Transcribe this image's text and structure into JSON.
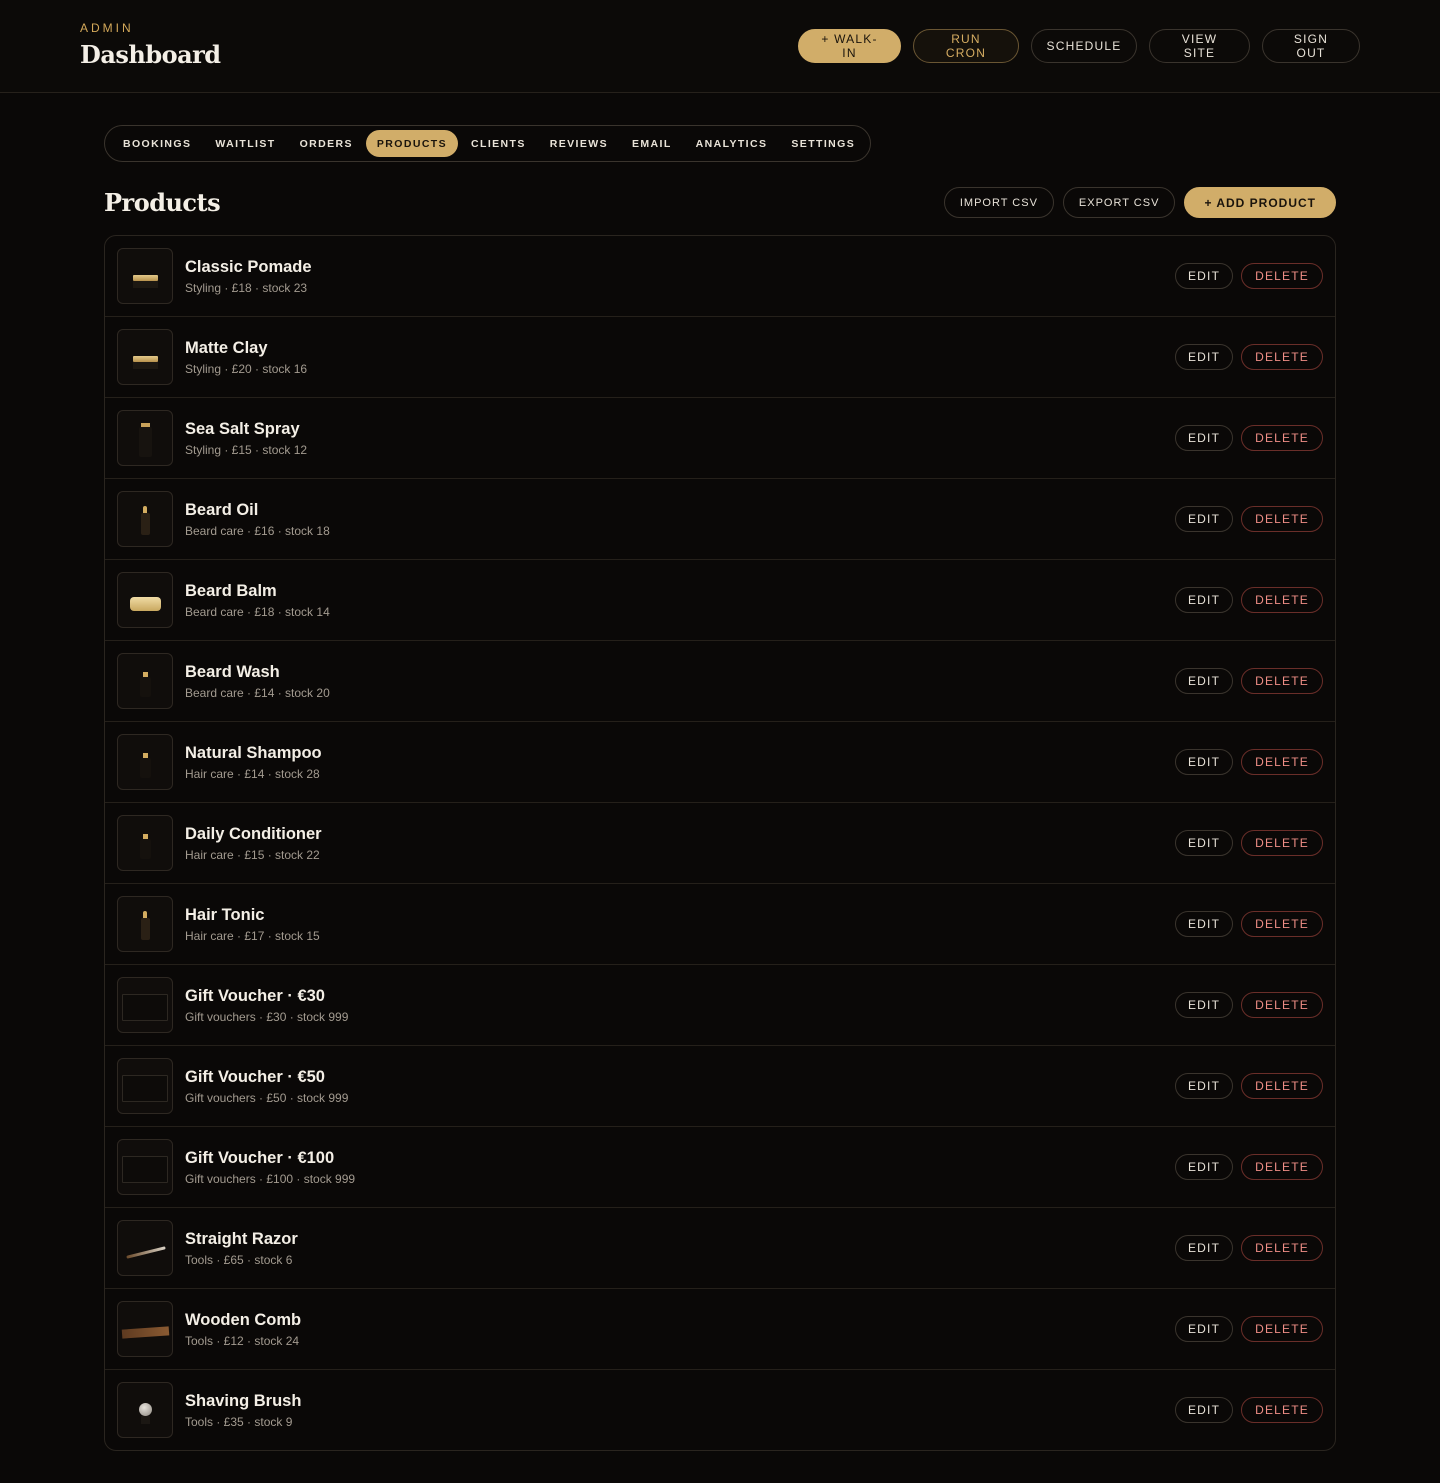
{
  "header": {
    "kicker": "ADMIN",
    "title": "Dashboard",
    "actions": {
      "walkin": "+ WALK-IN",
      "run_cron": "RUN CRON",
      "schedule": "SCHEDULE",
      "view_site": "VIEW SITE",
      "sign_out": "SIGN OUT"
    }
  },
  "tabs": [
    {
      "label": "BOOKINGS"
    },
    {
      "label": "WAITLIST"
    },
    {
      "label": "ORDERS"
    },
    {
      "label": "PRODUCTS"
    },
    {
      "label": "CLIENTS"
    },
    {
      "label": "REVIEWS"
    },
    {
      "label": "EMAIL"
    },
    {
      "label": "ANALYTICS"
    },
    {
      "label": "SETTINGS"
    }
  ],
  "active_tab": "PRODUCTS",
  "section": {
    "title": "Products",
    "import": "IMPORT CSV",
    "export": "EXPORT CSV",
    "add": "+ ADD PRODUCT"
  },
  "row_actions": {
    "edit": "EDIT",
    "delete": "DELETE"
  },
  "products": [
    {
      "name": "Classic Pomade",
      "meta": "Styling · £18 · stock 23",
      "thumb": "tin"
    },
    {
      "name": "Matte Clay",
      "meta": "Styling · £20 · stock 16",
      "thumb": "tin"
    },
    {
      "name": "Sea Salt Spray",
      "meta": "Styling · £15 · stock 12",
      "thumb": "spray-bottle"
    },
    {
      "name": "Beard Oil",
      "meta": "Beard care · £16 · stock 18",
      "thumb": "dropper-bottle"
    },
    {
      "name": "Beard Balm",
      "meta": "Beard care · £18 · stock 14",
      "thumb": "balm-tin"
    },
    {
      "name": "Beard Wash",
      "meta": "Beard care · £14 · stock 20",
      "thumb": "bottle"
    },
    {
      "name": "Natural Shampoo",
      "meta": "Hair care · £14 · stock 28",
      "thumb": "bottle"
    },
    {
      "name": "Daily Conditioner",
      "meta": "Hair care · £15 · stock 22",
      "thumb": "bottle"
    },
    {
      "name": "Hair Tonic",
      "meta": "Hair care · £17 · stock 15",
      "thumb": "dropper-bottle"
    },
    {
      "name": "Gift Voucher · €30",
      "meta": "Gift vouchers · £30 · stock 999",
      "thumb": "voucher"
    },
    {
      "name": "Gift Voucher · €50",
      "meta": "Gift vouchers · £50 · stock 999",
      "thumb": "voucher"
    },
    {
      "name": "Gift Voucher · €100",
      "meta": "Gift vouchers · £100 · stock 999",
      "thumb": "voucher"
    },
    {
      "name": "Straight Razor",
      "meta": "Tools · £65 · stock 6",
      "thumb": "razor"
    },
    {
      "name": "Wooden Comb",
      "meta": "Tools · £12 · stock 24",
      "thumb": "comb"
    },
    {
      "name": "Shaving Brush",
      "meta": "Tools · £35 · stock 9",
      "thumb": "brush"
    }
  ]
}
